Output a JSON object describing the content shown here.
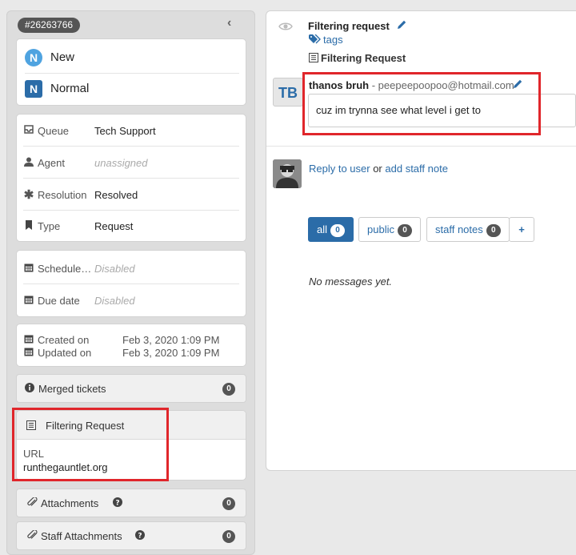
{
  "ticket": {
    "id": "#26263766",
    "status": {
      "letter": "N",
      "label": "New"
    },
    "priority": {
      "letter": "N",
      "label": "Normal"
    }
  },
  "properties": [
    {
      "icon": "inbox-icon",
      "label": "Queue",
      "value": "Tech Support",
      "muted": false
    },
    {
      "icon": "user-icon",
      "label": "Agent",
      "value": "unassigned",
      "muted": true
    },
    {
      "icon": "asterisk-icon",
      "label": "Resolution",
      "value": "Resolved",
      "muted": false
    },
    {
      "icon": "bookmark-icon",
      "label": "Type",
      "value": "Request",
      "muted": false
    }
  ],
  "schedule": [
    {
      "label": "Schedule…",
      "value": "Disabled"
    },
    {
      "label": "Due date",
      "value": "Disabled"
    }
  ],
  "dates": {
    "created_label": "Created on",
    "created_value": "Feb 3, 2020 1:09 PM",
    "updated_label": "Updated on",
    "updated_value": "Feb 3, 2020 1:09 PM"
  },
  "merged": {
    "label": "Merged tickets",
    "count": "0"
  },
  "form": {
    "title": "Filtering Request",
    "field_label": "URL",
    "field_value": "runthegauntlet.org"
  },
  "attachments": {
    "label": "Attachments",
    "count": "0"
  },
  "staff_attachments": {
    "label": "Staff Attachments",
    "count": "0"
  },
  "request": {
    "title": "Filtering request",
    "tag_link": "tags",
    "form_name": "Filtering Request"
  },
  "message": {
    "initials": "TB",
    "author": "thanos bruh",
    "separator": " - ",
    "email": "peepeepoopoo@hotmail.com",
    "body": "cuz im trynna see what level i get to"
  },
  "reply": {
    "reply_link": "Reply to user",
    "or_text": " or ",
    "note_link": "add staff note"
  },
  "tabs": [
    {
      "label": "all",
      "count": "0",
      "active": true
    },
    {
      "label": "public",
      "count": "0",
      "active": false
    },
    {
      "label": "staff notes",
      "count": "0",
      "active": false
    }
  ],
  "add_tab_label": "+",
  "empty_state": "No messages yet.",
  "colors": {
    "accent": "#2b6ca8",
    "highlight": "#e0262b",
    "status_new": "#4fa3e0"
  }
}
